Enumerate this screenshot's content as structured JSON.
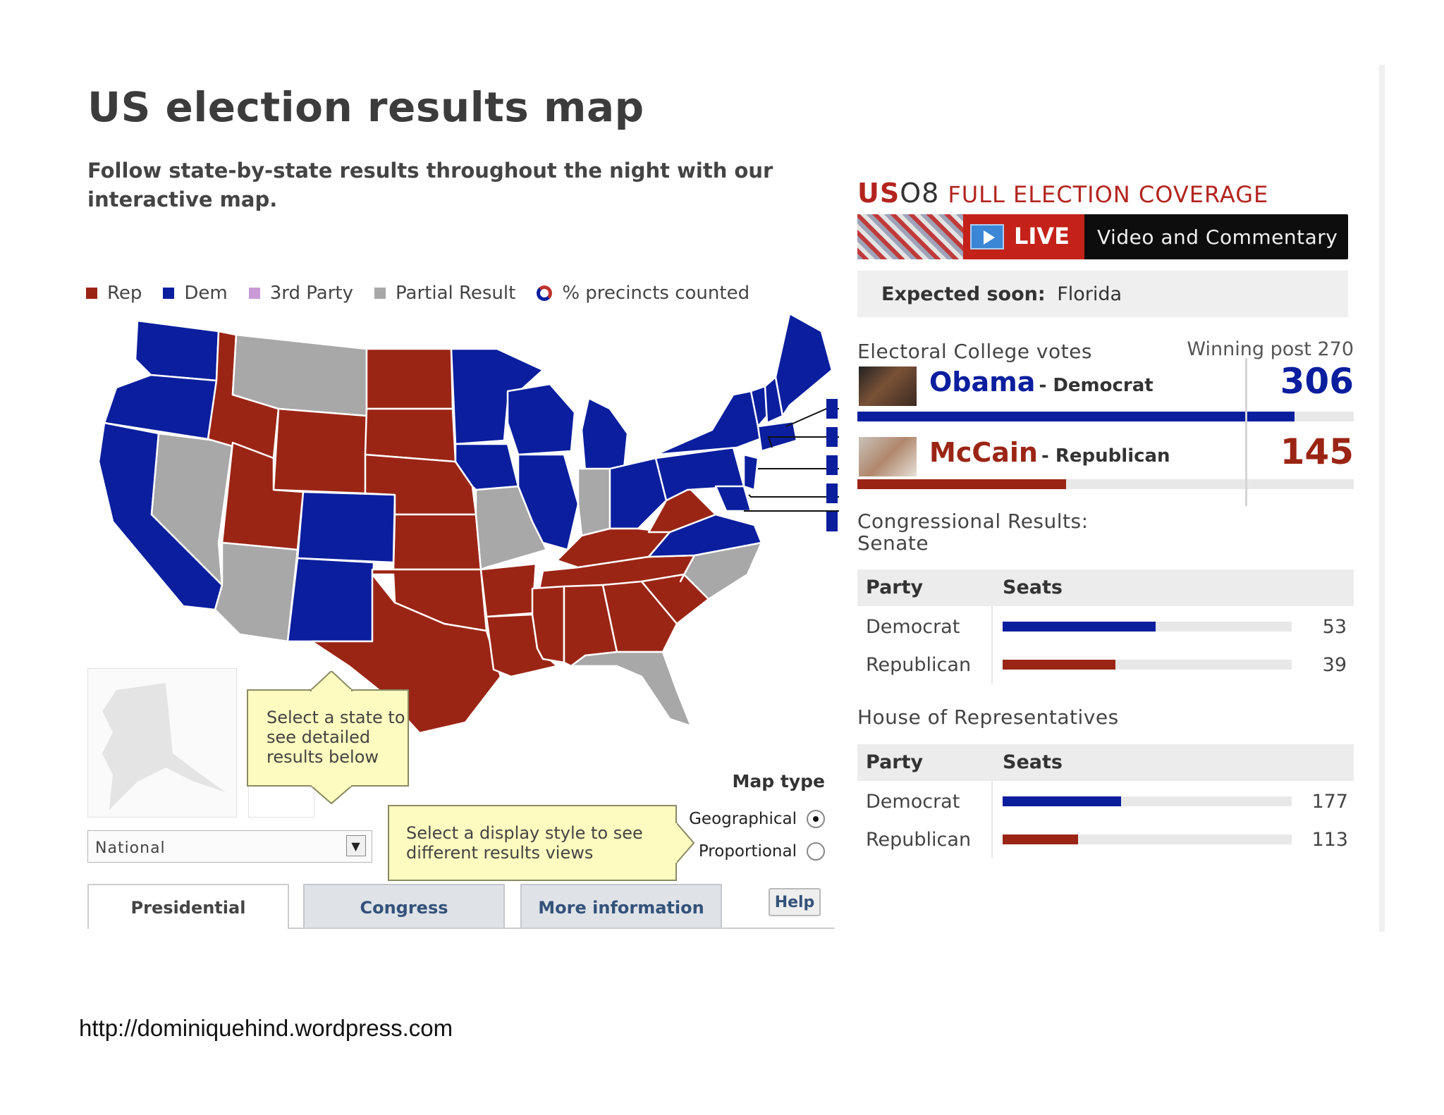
{
  "header": {
    "title": "US election results map",
    "subtitle": "Follow state-by-state results throughout the night with our interactive map."
  },
  "legend": {
    "items": [
      {
        "label": "Rep",
        "color": "#9b2515"
      },
      {
        "label": "Dem",
        "color": "#0a1e9e"
      },
      {
        "label": "3rd Party",
        "color": "#c99ad6"
      },
      {
        "label": "Partial Result",
        "color": "#a8a8a8"
      }
    ],
    "precincts_label": "% precincts counted"
  },
  "colors": {
    "rep": "#9b2515",
    "dem": "#0a1e9e",
    "partial": "#a8a8a8",
    "undecided": "#a8a8a8"
  },
  "map": {
    "tooltip_state": "Select a state to see detailed results below",
    "tooltip_display": "Select a display style to see different results views",
    "region_select": {
      "selected": "National"
    },
    "map_type": {
      "label": "Map type",
      "options": [
        {
          "label": "Geographical",
          "selected": true
        },
        {
          "label": "Proportional",
          "selected": false
        }
      ]
    }
  },
  "tabs": [
    {
      "label": "Presidential",
      "active": true
    },
    {
      "label": "Congress",
      "active": false
    },
    {
      "label": "More information",
      "active": false
    }
  ],
  "help_label": "Help",
  "coverage": {
    "us": "US",
    "o8": "O8",
    "heading": "FULL ELECTION COVERAGE",
    "live_label": "LIVE",
    "live_desc": "Video and Commentary"
  },
  "expected": {
    "label": "Expected soon:",
    "value": "Florida"
  },
  "electoral": {
    "label": "Electoral College votes",
    "winning_post": "Winning post 270",
    "winning_threshold": 270,
    "total": 538,
    "candidates": [
      {
        "name": "Obama",
        "party": "- Democrat",
        "votes": 306,
        "bar_fraction": 0.88,
        "color": "#0a1e9e"
      },
      {
        "name": "McCain",
        "party": "- Republican",
        "votes": 145,
        "bar_fraction": 0.42,
        "color": "#9b2515"
      }
    ]
  },
  "senate": {
    "title": "Congressional Results: Senate",
    "columns": [
      "Party",
      "Seats"
    ],
    "rows": [
      {
        "party": "Democrat",
        "seats": "53",
        "bar_fraction": 0.53,
        "color": "#0a1e9e"
      },
      {
        "party": "Republican",
        "seats": "39",
        "bar_fraction": 0.39,
        "color": "#9b2515"
      }
    ]
  },
  "house": {
    "title": "House of Representatives",
    "columns": [
      "Party",
      "Seats"
    ],
    "rows": [
      {
        "party": "Democrat",
        "seats": "177",
        "bar_fraction": 0.41,
        "color": "#0a1e9e"
      },
      {
        "party": "Republican",
        "seats": "113",
        "bar_fraction": 0.26,
        "color": "#9b2515"
      }
    ]
  },
  "footer": {
    "url": "http://dominiquehind.wordpress.com"
  }
}
